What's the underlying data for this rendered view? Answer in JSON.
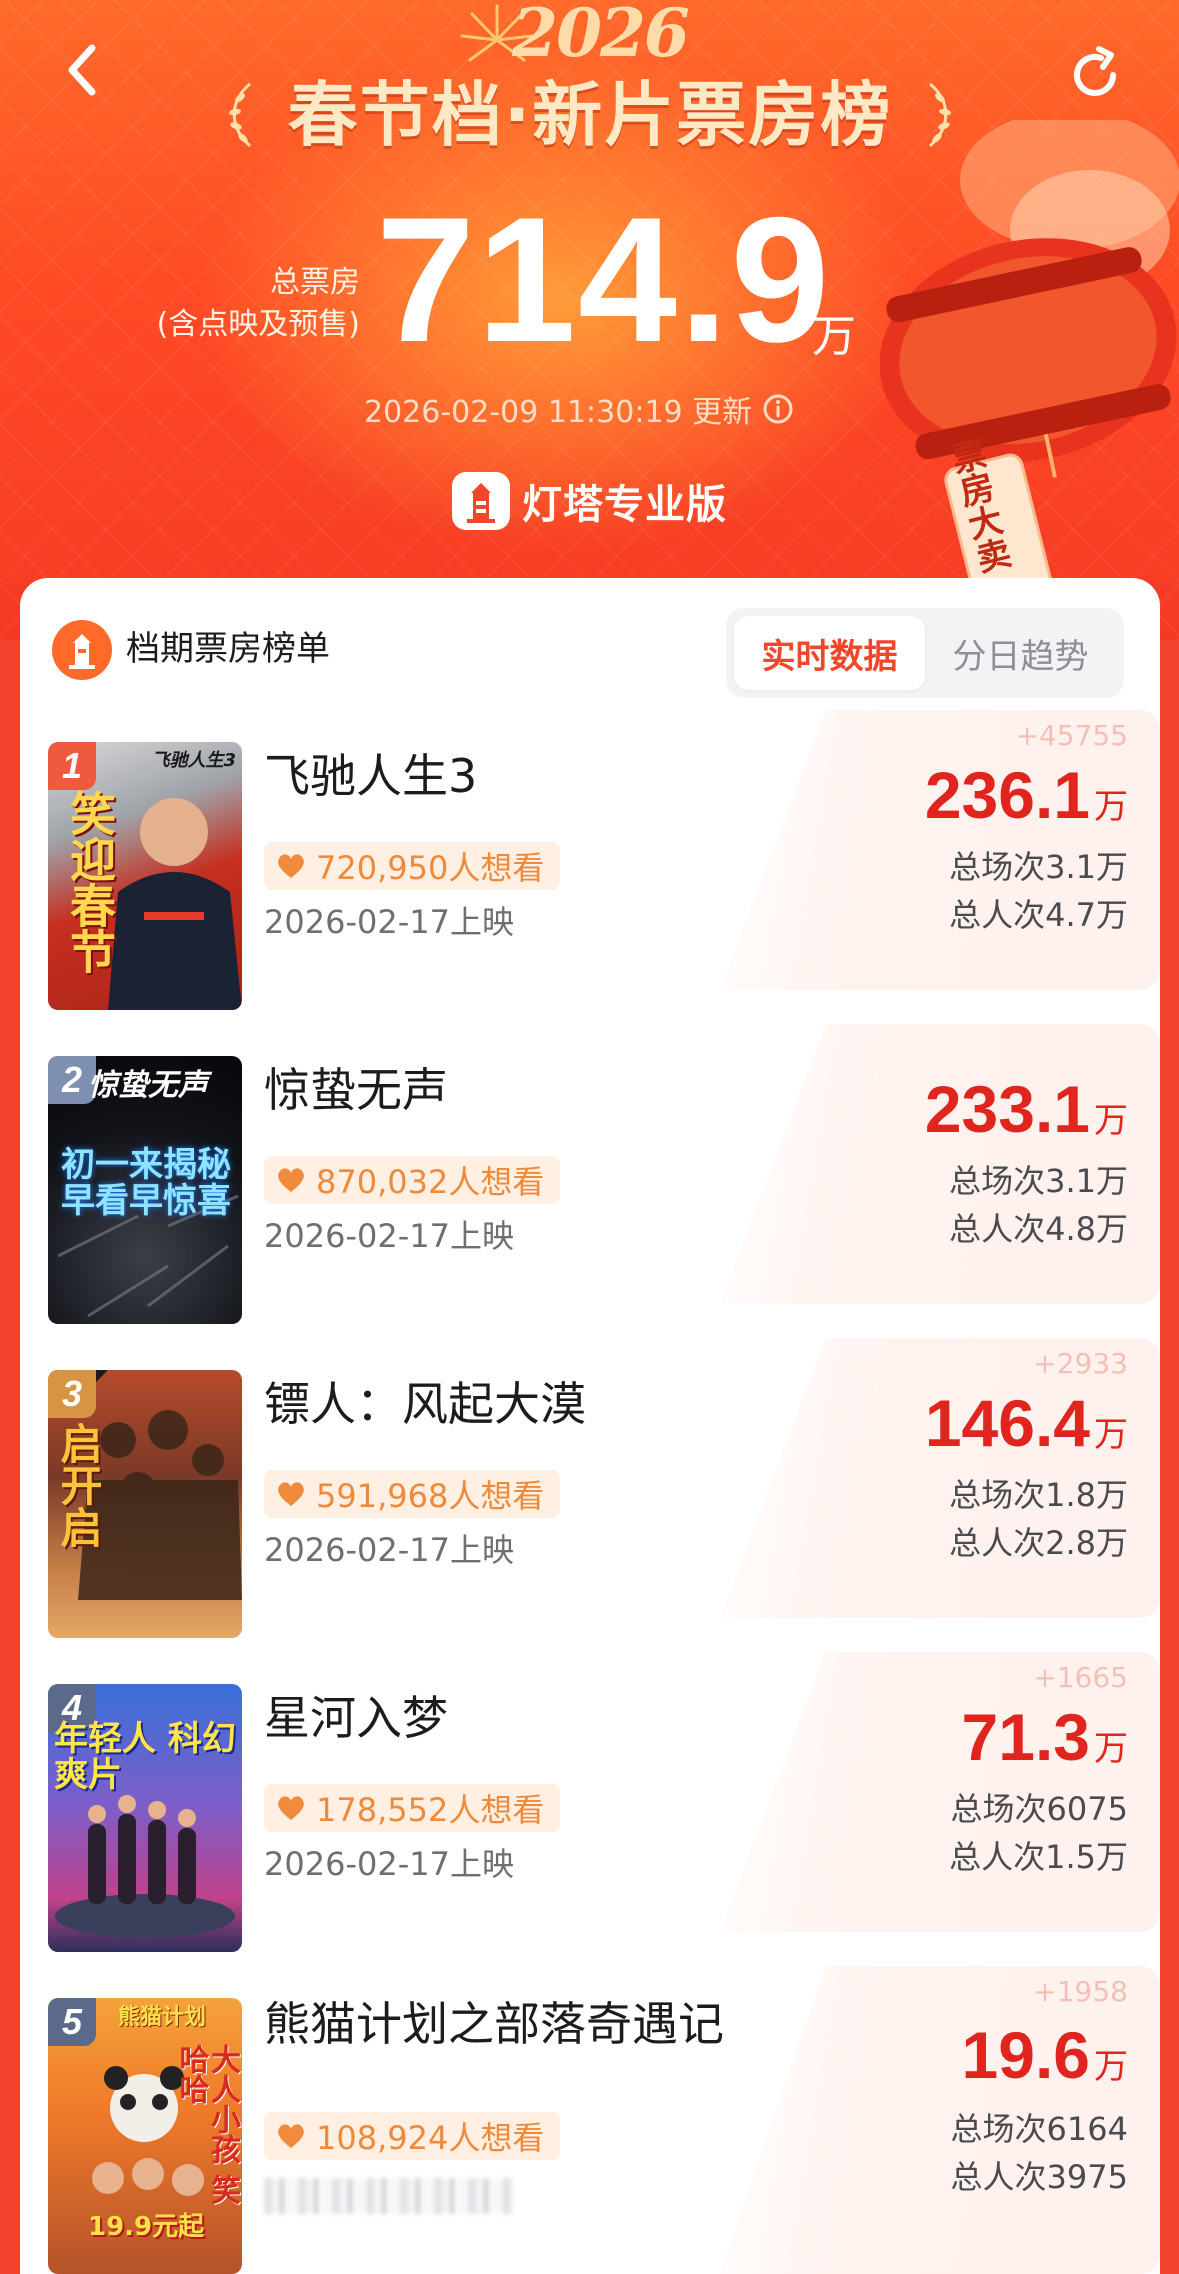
{
  "header": {
    "year": "2026",
    "title": "春节档·新片票房榜",
    "total_label_line1": "总票房",
    "total_label_line2": "(含点映及预售)",
    "total_value": "714.9",
    "total_unit": "万",
    "updated_at": "2026-02-09 11:30:19 更新",
    "brand": "灯塔专业版",
    "lantern_tag": "票房大卖",
    "colors": {
      "accent": "#f4432c",
      "gold": "#ffe9c4"
    },
    "icons": {
      "back": "back-arrow-icon",
      "refresh": "refresh-icon",
      "info": "info-icon"
    }
  },
  "section": {
    "title": "档期票房榜单",
    "tabs": [
      {
        "label": "实时数据",
        "active": true
      },
      {
        "label": "分日趋势",
        "active": false
      }
    ]
  },
  "movies": [
    {
      "rank": "1",
      "title": "飞驰人生3",
      "want_to_see": "720,950人想看",
      "release": "2026-02-17上映",
      "delta": "+45755",
      "box_office": "236.1",
      "box_unit": "万",
      "shows": "总场次3.1万",
      "admissions": "总人次4.7万",
      "poster_text": "笑迎春节",
      "poster_caption": "飞驰人生3"
    },
    {
      "rank": "2",
      "title": "惊蛰无声",
      "want_to_see": "870,032人想看",
      "release": "2026-02-17上映",
      "delta": "",
      "box_office": "233.1",
      "box_unit": "万",
      "shows": "总场次3.1万",
      "admissions": "总人次4.8万",
      "poster_text": "初一来揭秘 早看早惊喜",
      "poster_caption": "惊蛰无声"
    },
    {
      "rank": "3",
      "title": "镖人：风起大漠",
      "want_to_see": "591,968人想看",
      "release": "2026-02-17上映",
      "delta": "+2933",
      "box_office": "146.4",
      "box_unit": "万",
      "shows": "总场次1.8万",
      "admissions": "总人次2.8万",
      "poster_text": "启开启"
    },
    {
      "rank": "4",
      "title": "星河入梦",
      "want_to_see": "178,552人想看",
      "release": "2026-02-17上映",
      "delta": "+1665",
      "box_office": "71.3",
      "box_unit": "万",
      "shows": "总场次6075",
      "admissions": "总人次1.5万",
      "poster_text": "年轻人 科幻爽片"
    },
    {
      "rank": "5",
      "title": "熊猫计划之部落奇遇记",
      "want_to_see": "108,924人想看",
      "release": "",
      "delta": "+1958",
      "box_office": "19.6",
      "box_unit": "万",
      "shows": "总场次6164",
      "admissions": "总人次3975",
      "poster_text": "大人小孩 笑哈哈",
      "poster_price": "19.9元起",
      "poster_caption": "熊猫计划"
    }
  ]
}
